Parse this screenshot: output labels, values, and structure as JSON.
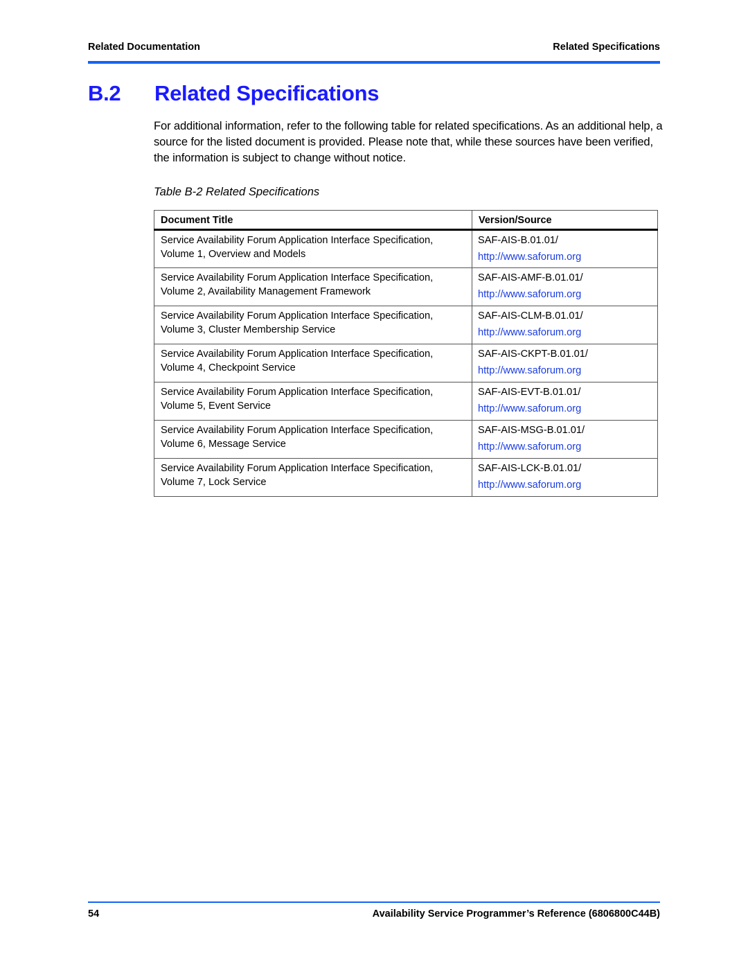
{
  "header": {
    "left": "Related Documentation",
    "right": "Related Specifications"
  },
  "section": {
    "number": "B.2",
    "title": "Related Specifications"
  },
  "intro": "For additional information, refer to the following table for related specifications. As an additional help, a source for the listed document is provided. Please note that, while these sources have been verified, the information is subject to change without notice.",
  "table": {
    "caption": "Table B-2 Related Specifications",
    "columns": [
      "Document Title",
      "Version/Source"
    ],
    "rows": [
      {
        "title_line1": "Service Availability Forum Application Interface Specification,",
        "title_line2": "Volume 1, Overview and Models",
        "version": "SAF-AIS-B.01.01/",
        "source": "http://www.saforum.org"
      },
      {
        "title_line1": "Service Availability Forum Application Interface Specification,",
        "title_line2": "Volume 2, Availability Management Framework",
        "version": "SAF-AIS-AMF-B.01.01/",
        "source": "http://www.saforum.org"
      },
      {
        "title_line1": "Service Availability Forum Application Interface Specification,",
        "title_line2": "Volume 3, Cluster Membership Service",
        "version": "SAF-AIS-CLM-B.01.01/",
        "source": "http://www.saforum.org"
      },
      {
        "title_line1": "Service Availability Forum Application Interface Specification,",
        "title_line2": "Volume 4, Checkpoint Service",
        "version": "SAF-AIS-CKPT-B.01.01/",
        "source": "http://www.saforum.org"
      },
      {
        "title_line1": "Service Availability Forum Application Interface Specification,",
        "title_line2": "Volume 5, Event Service",
        "version": "SAF-AIS-EVT-B.01.01/",
        "source": "http://www.saforum.org"
      },
      {
        "title_line1": "Service Availability Forum Application Interface Specification,",
        "title_line2": "Volume 6, Message Service",
        "version": "SAF-AIS-MSG-B.01.01/",
        "source": "http://www.saforum.org"
      },
      {
        "title_line1": "Service Availability Forum Application Interface Specification,",
        "title_line2": "Volume 7, Lock Service",
        "version": "SAF-AIS-LCK-B.01.01/",
        "source": "http://www.saforum.org"
      }
    ]
  },
  "footer": {
    "page_number": "54",
    "doc_title": "Availability Service Programmer’s Reference (6806800C44B)"
  },
  "colors": {
    "heading": "#1a1aff",
    "rule": "#1464f4",
    "link": "#1a3ce0"
  }
}
